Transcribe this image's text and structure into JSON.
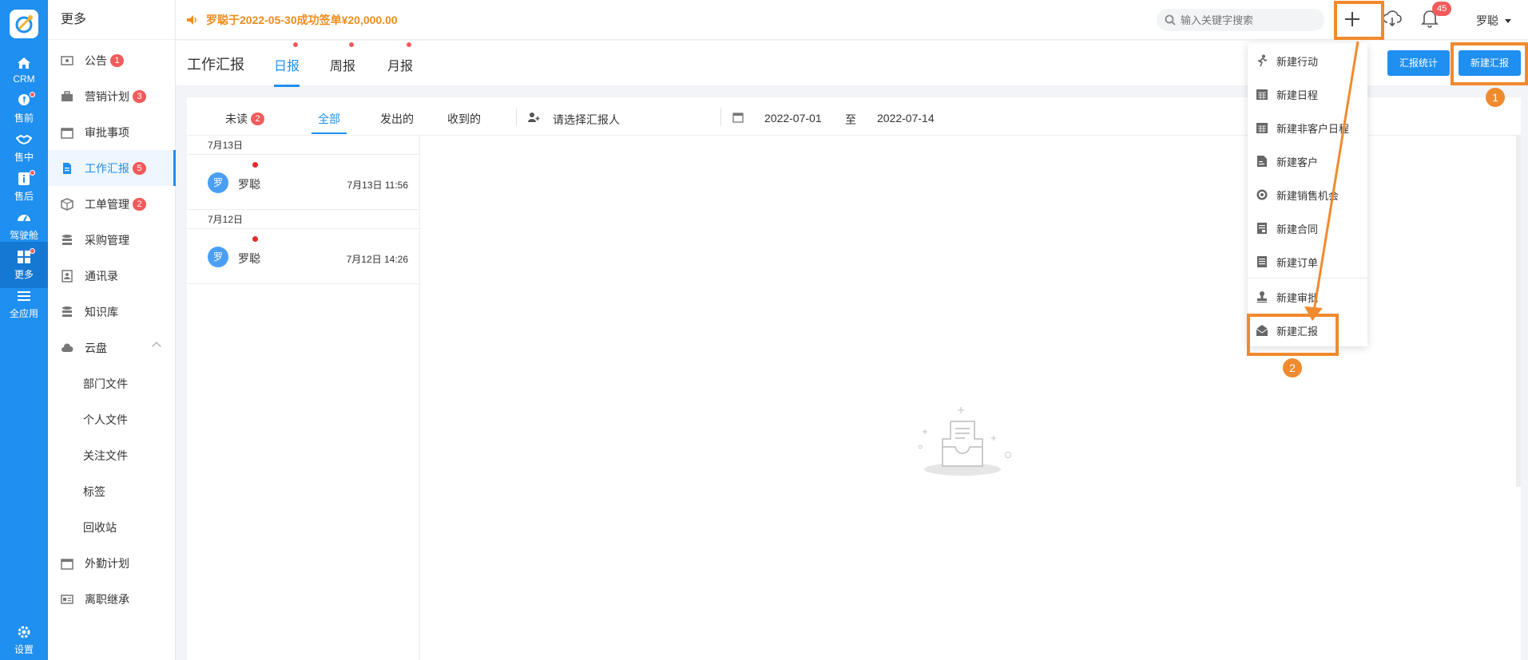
{
  "rail": {
    "items": [
      {
        "label": "CRM",
        "icon": "home-icon"
      },
      {
        "label": "售前",
        "icon": "pin-icon"
      },
      {
        "label": "售中",
        "icon": "handshake-icon"
      },
      {
        "label": "售后",
        "icon": "info-icon"
      },
      {
        "label": "驾驶舱",
        "icon": "dashboard-icon"
      },
      {
        "label": "更多",
        "icon": "grid-icon"
      },
      {
        "label": "全应用",
        "icon": "menu-icon"
      },
      {
        "label": "设置",
        "icon": "gear-icon"
      }
    ]
  },
  "sidebar": {
    "title": "更多",
    "items": [
      {
        "label": "公告",
        "badge": "1"
      },
      {
        "label": "营销计划",
        "badge": "3"
      },
      {
        "label": "审批事项",
        "badge": ""
      },
      {
        "label": "工作汇报",
        "badge": "5"
      },
      {
        "label": "工单管理",
        "badge": "2"
      },
      {
        "label": "采购管理",
        "badge": ""
      },
      {
        "label": "通讯录",
        "badge": ""
      },
      {
        "label": "知识库",
        "badge": ""
      },
      {
        "label": "云盘",
        "badge": ""
      },
      {
        "label": "部门文件",
        "badge": ""
      },
      {
        "label": "个人文件",
        "badge": ""
      },
      {
        "label": "关注文件",
        "badge": ""
      },
      {
        "label": "标签",
        "badge": ""
      },
      {
        "label": "回收站",
        "badge": ""
      },
      {
        "label": "外勤计划",
        "badge": ""
      },
      {
        "label": "离职继承",
        "badge": ""
      }
    ]
  },
  "topbar": {
    "notice": "罗聪于2022-05-30成功签单¥20,000.00",
    "search_placeholder": "输入关键字搜索",
    "bell_count": "45",
    "user": "罗聪"
  },
  "header": {
    "title": "工作汇报",
    "tabs": [
      "日报",
      "周报",
      "月报"
    ],
    "stats_button": "汇报统计",
    "new_button": "新建汇报"
  },
  "filters": {
    "unread": "未读",
    "unread_count": "2",
    "all": "全部",
    "sent": "发出的",
    "received": "收到的",
    "reporter_placeholder": "请选择汇报人",
    "date_from": "2022-07-01",
    "date_to_label": "至",
    "date_to": "2022-07-14"
  },
  "reports": [
    {
      "date": "7月13日",
      "avatar": "罗",
      "name": "罗聪",
      "time": "7月13日 11:56"
    },
    {
      "date": "7月12日",
      "avatar": "罗",
      "name": "罗聪",
      "time": "7月12日 14:26"
    }
  ],
  "menu": {
    "items": [
      {
        "label": "新建行动",
        "icon": "run-icon"
      },
      {
        "label": "新建日程",
        "icon": "calendar-icon"
      },
      {
        "label": "新建非客户日程",
        "icon": "calendar-icon"
      },
      {
        "label": "新建客户",
        "icon": "customer-icon"
      },
      {
        "label": "新建销售机会",
        "icon": "target-icon"
      },
      {
        "label": "新建合同",
        "icon": "contract-icon"
      },
      {
        "label": "新建订单",
        "icon": "order-icon"
      },
      {
        "label": "新建审批",
        "icon": "stamp-icon"
      },
      {
        "label": "新建汇报",
        "icon": "report-icon"
      }
    ]
  },
  "annotations": {
    "step1": "1",
    "step2": "2"
  },
  "colors": {
    "accent": "#1f8ff0",
    "highlight": "#f08a2e",
    "badge": "#f25b5b",
    "notice": "#f08c1e"
  }
}
